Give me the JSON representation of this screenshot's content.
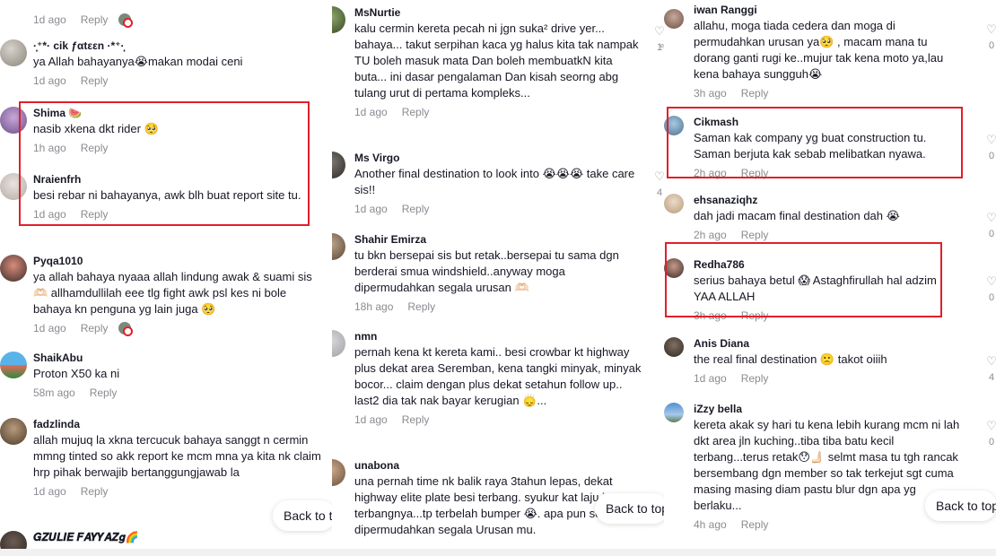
{
  "ui": {
    "reply_label": "Reply",
    "back_to_top": "Back to top",
    "accent_red": "#e0202a"
  },
  "col1": [
    {
      "name": "",
      "text": "",
      "time": "1d ago",
      "has_sticker": true
    },
    {
      "name": "·̩͙⁺*· cik ƒαtεεn ·*⁺·̩͙",
      "text": "ya Allah bahayanya😭makan modai ceni",
      "time": "1d ago"
    },
    {
      "name": "Shima 🍉",
      "text": "nasib xkena dkt rider 🥺",
      "time": "1h ago"
    },
    {
      "name": "Nraienfrh",
      "text": "besi rebar ni bahayanya, awk blh buat report site tu.",
      "time": "1d ago"
    },
    {
      "name": "Pyqa1010",
      "text": "ya allah bahaya nyaaa allah lindung awak & suami sis 🫶🏻 allhamdullilah eee tlg fight awk psl kes ni bole bahaya kn penguna yg lain juga 🥺",
      "time": "1d ago",
      "has_sticker": true
    },
    {
      "name": "ShaikAbu",
      "text": "Proton X50 ka ni",
      "time": "58m ago"
    },
    {
      "name": "fadzlinda",
      "text": "allah mujuq la xkna tercucuk bahaya sanggt n cermin mmng tinted so akk report ke mcm mna ya kita nk claim hrp pihak berwajib bertanggungjawab la",
      "time": "1d ago"
    },
    {
      "name": "𝑮𝒁𝑼𝑳𝑰𝑬 𝑭𝑨𝒀𝒀𝑨𝒁𝒈🌈",
      "text": "",
      "time": ""
    }
  ],
  "col2": [
    {
      "name": "MsNurtie",
      "text": "kalu cermin kereta pecah ni jgn suka² drive yer... bahaya... takut serpihan kaca yg halus kita tak nampak TU boleh masuk mata Dan boleh membuatkN kita buta... ini dasar pengalaman Dan kisah seorng abg tulang urut di pertama kompleks...",
      "time": "1d ago"
    },
    {
      "name": "Ms Virgo",
      "text": "Another final destination to look into 😭😭😭 take care sis!!",
      "time": "1d ago"
    },
    {
      "name": "Shahir Emirza",
      "text": "tu bkn bersepai sis but retak..bersepai tu sama dgn berderai smua windshield..anyway moga dipermudahkan segala urusan 🫶🏻",
      "time": "18h ago"
    },
    {
      "name": "nmn",
      "text": "pernah kena kt kereta kami.. besi crowbar kt highway plus dekat area Seremban, kena tangki minyak, minyak bocor... claim dengan plus dekat setahun follow up.. last2 dia tak nak bayar kerugian 🙂‍↕️...",
      "time": "1d ago"
    },
    {
      "name": "unabona",
      "text": "una pernah time nk balik raya 3tahun lepas, dekat highway elite plate besi terbang. syukur kat laju je terbangnya...tp terbelah bumper 😭. apa pun semoga dipermudahkan segala Urusan mu.",
      "time": ""
    }
  ],
  "col3": [
    {
      "name": "iwan Ranggi",
      "text": "allahu, moga tiada cedera dan moga di permudahkan urusan ya🥺 , macam mana tu dorang ganti rugi ke..mujur tak kena moto ya,lau kena bahaya sungguh😭",
      "time": "3h ago"
    },
    {
      "name": "Cikmash",
      "text": "Saman kak company yg buat construction tu. Saman berjuta kak sebab melibatkan nyawa.",
      "time": "2h ago"
    },
    {
      "name": "ehsanaziqhz",
      "text": "dah jadi macam final destination dah 😭",
      "time": "2h ago"
    },
    {
      "name": "Redha786",
      "text": "serius bahaya betul 😱 Astaghfirullah hal adzim YAA ALLAH",
      "time": "3h ago"
    },
    {
      "name": "Anis Diana",
      "text": "the real final destination 🙁 takot oiiih",
      "time": "1d ago"
    },
    {
      "name": "iZzy bella",
      "text": "kereta akak sy hari tu kena lebih kurang mcm ni lah dkt area jln kuching..tiba tiba batu kecil terbang...terus retak😯🫸🏻 selmt masa tu tgh rancak bersembang dgn member so tak terkejut sgt cuma masing masing diam pastu blur dgn apa yg berlaku...",
      "time": "4h ago"
    }
  ],
  "likes_col3": [
    "0",
    "0",
    "0",
    "0",
    "4",
    "0"
  ],
  "likes_col2": [
    "1ͤ",
    "4",
    "",
    "",
    ""
  ]
}
